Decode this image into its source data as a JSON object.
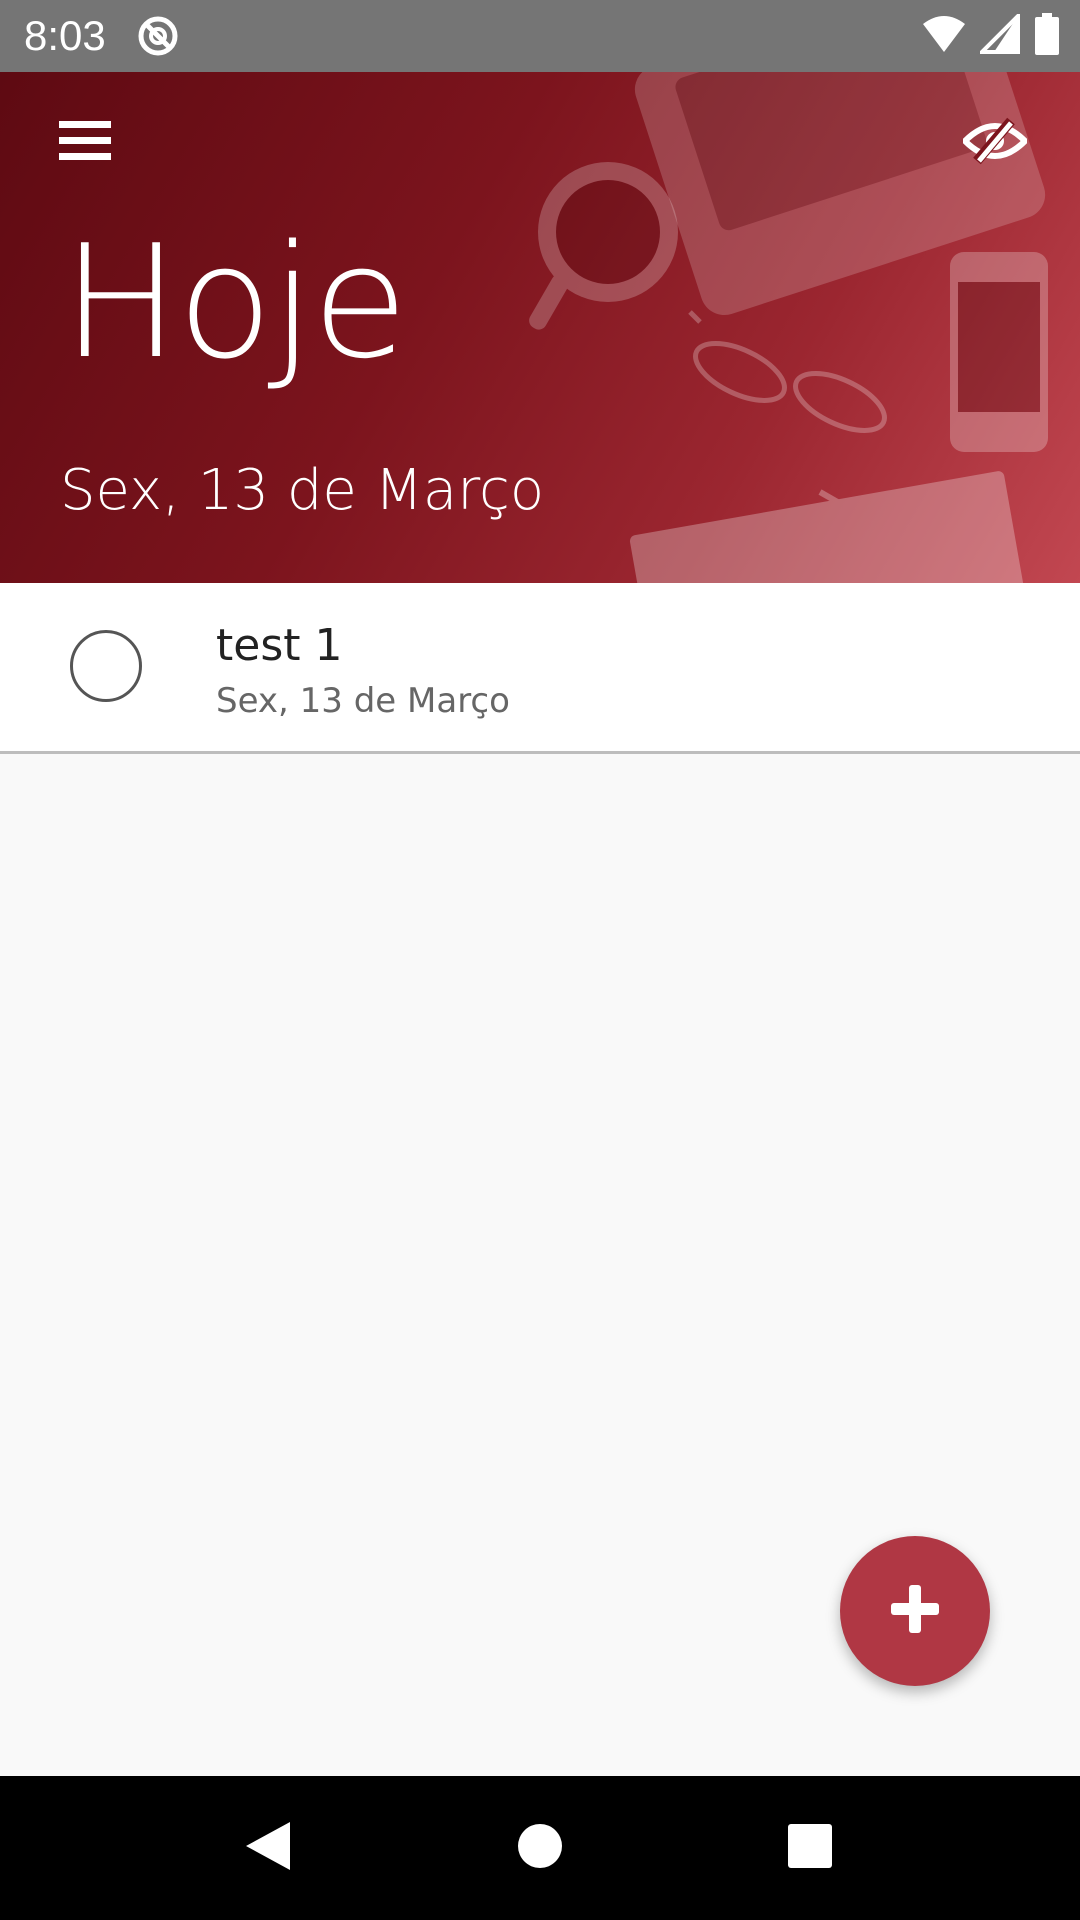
{
  "status_bar": {
    "time": "8:03",
    "app_icon": "app-notification-icon",
    "icons": [
      "wifi-icon",
      "cellular-signal-icon",
      "battery-icon"
    ]
  },
  "header": {
    "title": "Hoje",
    "date": "Sex, 13 de Março",
    "menu_icon": "hamburger-menu-icon",
    "visibility_icon": "eye-off-icon"
  },
  "tasks": [
    {
      "title": "test 1",
      "date": "Sex, 13 de Março",
      "completed": false
    }
  ],
  "fab": {
    "icon": "plus-icon",
    "color": "#b03744"
  },
  "nav_bar": {
    "buttons": [
      "back-icon",
      "home-icon",
      "recents-icon"
    ]
  },
  "colors": {
    "header_primary": "#7c141d",
    "accent": "#b03744",
    "background": "#f9f9f9",
    "status_bar": "#757575"
  }
}
